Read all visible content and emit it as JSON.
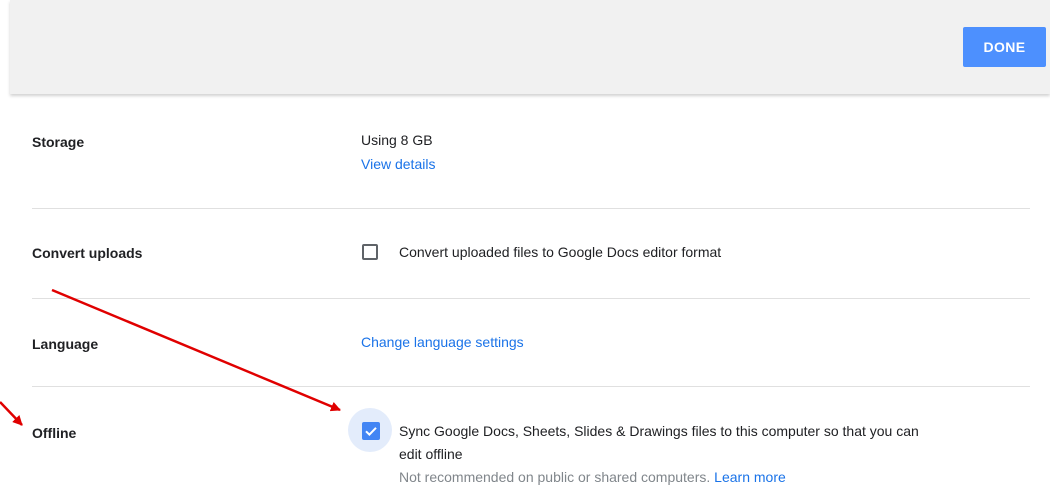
{
  "header": {
    "done_label": "DONE",
    "background": "#f1f1f1",
    "button_color": "#4d90fe"
  },
  "storage": {
    "label": "Storage",
    "usage": "Using 8 GB",
    "view_details": "View details"
  },
  "convert_uploads": {
    "label": "Convert uploads",
    "checkbox_label": "Convert uploaded files to Google Docs editor format",
    "checked": false
  },
  "language": {
    "label": "Language",
    "link": "Change language settings"
  },
  "offline": {
    "label": "Offline",
    "checkbox_label_line1": "Sync Google Docs, Sheets, Slides & Drawings files to this computer so that you can",
    "checkbox_label_line2": "edit offline",
    "note": "Not recommended on public or shared computers.",
    "learn_more": "Learn more",
    "checked": true
  },
  "annotation": {
    "arrow_color": "#e00000"
  },
  "colors": {
    "link": "#1a73e8",
    "checkbox_checked": "#4285f4",
    "divider": "#e0e0e0"
  }
}
